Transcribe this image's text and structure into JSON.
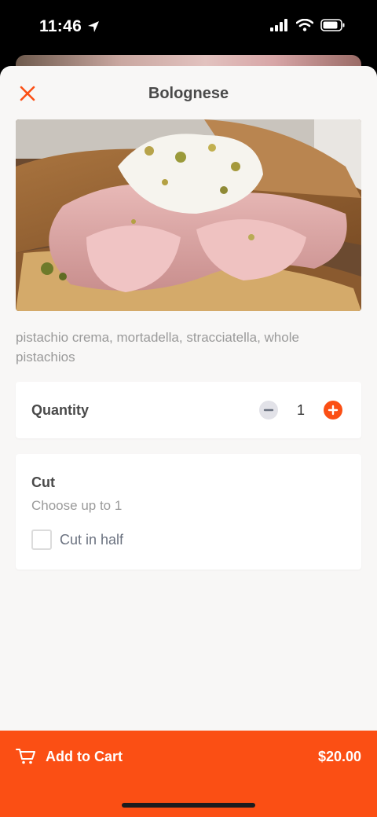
{
  "status_bar": {
    "time": "11:46"
  },
  "header": {
    "title": "Bolognese"
  },
  "product": {
    "description": "pistachio crema, mortadella, stracciatella, whole pistachios"
  },
  "quantity": {
    "label": "Quantity",
    "value": "1"
  },
  "cut": {
    "title": "Cut",
    "subtitle": "Choose up to 1",
    "options": [
      {
        "label": "Cut in half",
        "checked": false
      }
    ]
  },
  "cart": {
    "label": "Add to Cart",
    "price": "$20.00"
  },
  "colors": {
    "accent": "#fb4f14",
    "sheet_background": "#f8f7f6",
    "card_background": "#ffffff"
  },
  "icons": {
    "close": "close-icon",
    "minus": "minus-icon",
    "plus": "plus-icon",
    "cart": "cart-icon",
    "location": "location-arrow-icon",
    "signal": "signal-icon",
    "wifi": "wifi-icon",
    "battery": "battery-icon"
  }
}
